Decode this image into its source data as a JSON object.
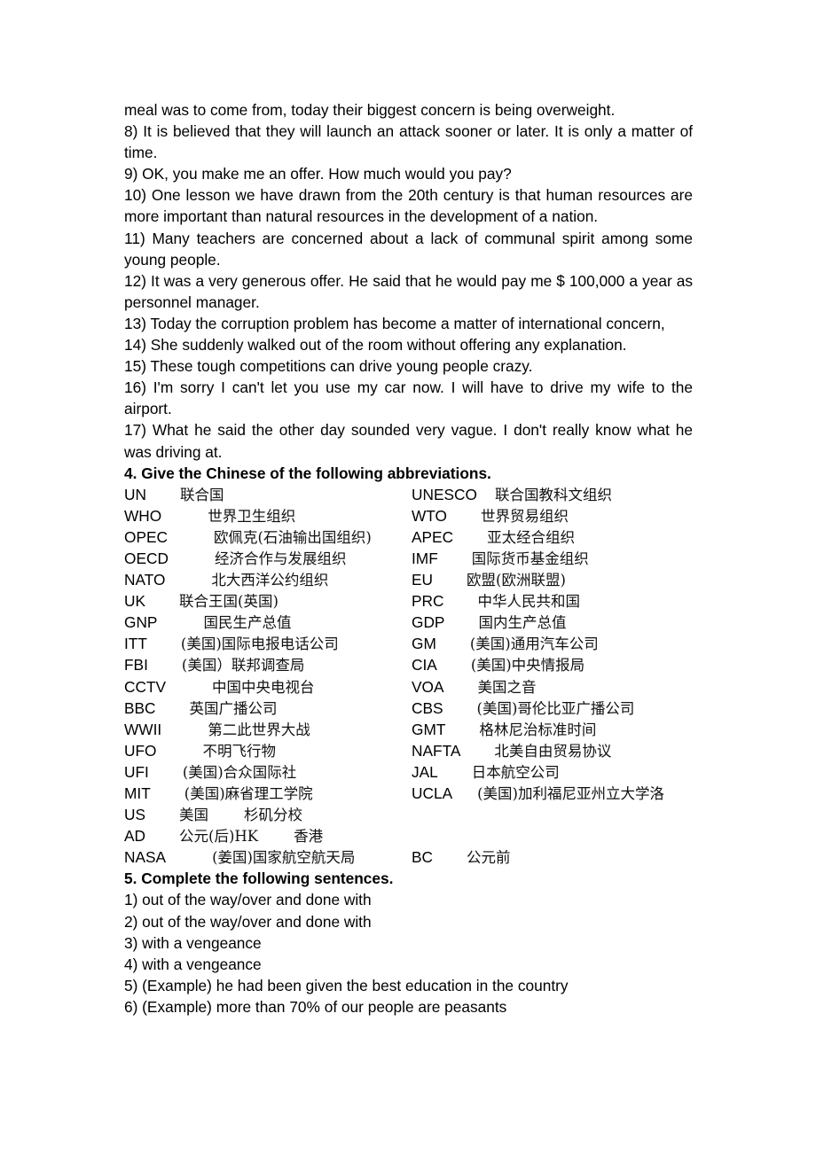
{
  "section3_continuation": {
    "items": [
      "meal was to come from, today their biggest concern is being overweight.",
      "8) It is believed that they will launch an attack sooner or later. It is only a matter of time.",
      "9) OK, you make me an offer. How much would you pay?",
      "10) One lesson we have drawn from the 20th century is that human resources are more important than natural resources in the development of a nation.",
      "11) Many teachers are concerned about a lack of communal spirit among some young people.",
      "12) It was a very generous offer. He said that he would pay me $ 100,000 a year as personnel manager.",
      "13) Today the corruption problem has become a matter of international concern,",
      "14) She suddenly walked out of the room without offering any explanation.",
      "15) These tough competitions can drive young people crazy.",
      "16) I'm sorry I can't let you use my car now. I will have to drive my wife to the airport.",
      "17) What he said the other day sounded very vague. I don't really know what he was driving at."
    ]
  },
  "section4": {
    "heading": "4. Give the Chinese of the following abbreviations.",
    "rows": [
      {
        "left": {
          "abbr": "UN",
          "zh": "联合国"
        },
        "right": {
          "abbr": "UNESCO",
          "zh": "联合国教科文组织"
        }
      },
      {
        "left": {
          "abbr": "WHO",
          "zh": "世界卫生组织"
        },
        "right": {
          "abbr": "WTO",
          "zh": "世界贸易组织"
        }
      },
      {
        "left": {
          "abbr": "OPEC",
          "zh": "欧佩克(石油输出国组织)"
        },
        "right": {
          "abbr": "APEC",
          "zh": "亚太经合组织"
        }
      },
      {
        "left": {
          "abbr": "OECD",
          "zh": "经济合作与发展组织"
        },
        "right": {
          "abbr": "IMF",
          "zh": "国际货币基金组织"
        }
      },
      {
        "left": {
          "abbr": "NATO",
          "zh": "北大西洋公约组织"
        },
        "right": {
          "abbr": "EU",
          "zh": "欧盟(欧洲联盟)"
        }
      },
      {
        "left": {
          "abbr": "UK",
          "zh": "联合王国(英国)"
        },
        "right": {
          "abbr": "PRC",
          "zh": "中华人民共和国"
        }
      },
      {
        "left": {
          "abbr": "GNP",
          "zh": "国民生产总值"
        },
        "right": {
          "abbr": "GDP",
          "zh": "国内生产总值"
        }
      },
      {
        "left": {
          "abbr": "ITT",
          "zh": "(美国)国际电报电话公司"
        },
        "right": {
          "abbr": "GM",
          "zh": "(美国)通用汽车公司"
        }
      },
      {
        "left": {
          "abbr": "FBI",
          "zh": "(美国）联邦调查局"
        },
        "right": {
          "abbr": "CIA",
          "zh": "(美国)中央情报局"
        }
      },
      {
        "left": {
          "abbr": "CCTV",
          "zh": "中国中央电视台"
        },
        "right": {
          "abbr": "VOA",
          "zh": "美国之音"
        }
      },
      {
        "left": {
          "abbr": "BBC",
          "zh": "英国广播公司"
        },
        "right": {
          "abbr": "CBS",
          "zh": "(美国)哥伦比亚广播公司"
        }
      },
      {
        "left": {
          "abbr": "WWII",
          "zh": "第二此世界大战"
        },
        "right": {
          "abbr": "GMT",
          "zh": "格林尼治标准时间"
        }
      },
      {
        "left": {
          "abbr": "UFO",
          "zh": "不明飞行物"
        },
        "right": {
          "abbr": "NAFTA",
          "zh": "北美自由贸易协议"
        }
      },
      {
        "left": {
          "abbr": "UFI",
          "zh": "(美国)合众国际社"
        },
        "right": {
          "abbr": "JAL",
          "zh": "日本航空公司"
        }
      },
      {
        "left": {
          "abbr": "MIT",
          "zh": "(美国)麻省理工学院"
        },
        "right": {
          "abbr": "UCLA",
          "zh": "(美国)加利福尼亚州立大学洛"
        }
      },
      {
        "left": {
          "abbr": "US",
          "zh": "美国",
          "extra": "杉矶分校"
        },
        "right": null
      },
      {
        "left": {
          "abbr": "AD",
          "zh": "公元(后)HK",
          "extra": "香港"
        },
        "right": null
      },
      {
        "left": {
          "abbr": "NASA",
          "zh": "(姜国)国家航空航天局"
        },
        "right": {
          "abbr": "BC",
          "zh": "公元前"
        }
      }
    ]
  },
  "section5": {
    "heading": "5. Complete the following sentences.",
    "items": [
      "1) out of the way/over and done with",
      "2) out of the way/over and done with",
      "3) with a vengeance",
      "4) with a vengeance",
      "5) (Example) he had been given the best education in the country",
      "6) (Example) more than 70% of our people are peasants"
    ]
  }
}
